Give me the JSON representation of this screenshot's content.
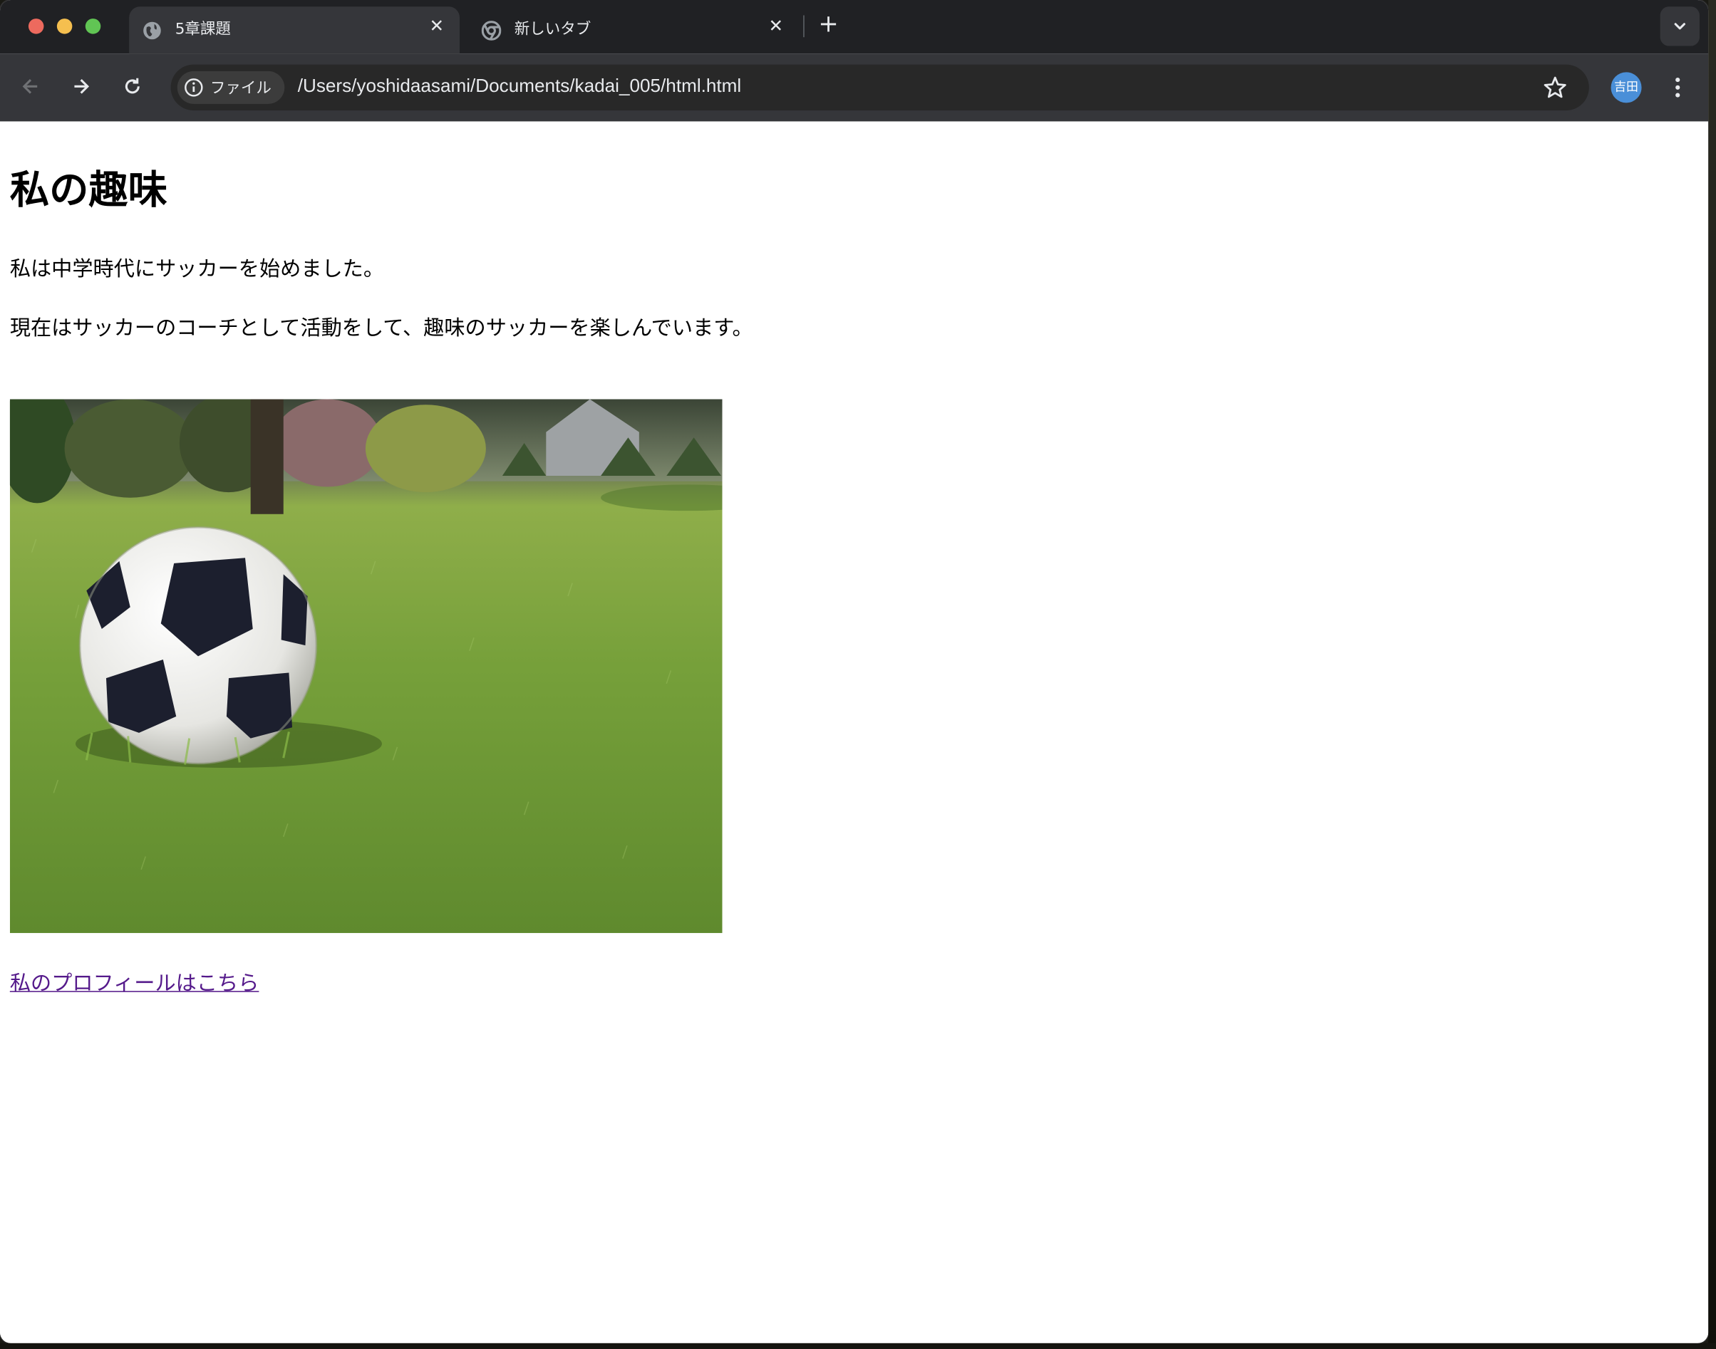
{
  "browser": {
    "tabs": [
      {
        "title": "5章課題",
        "active": true
      },
      {
        "title": "新しいタブ",
        "active": false
      }
    ],
    "close_glyph": "✕",
    "new_tab_glyph": "+",
    "toolbar": {
      "chip_label": "ファイル",
      "url": "/Users/yoshidaasami/Documents/kadai_005/html.html",
      "profile_initials": "吉田"
    }
  },
  "page": {
    "heading": "私の趣味",
    "paragraph_1": "私は中学時代にサッカーを始めました。",
    "paragraph_2": "現在はサッカーのコーチとして活動をして、趣味のサッカーを楽しんでいます。",
    "image_subject": "soccer ball on grass",
    "link_text": "私のプロフィールはこちら"
  },
  "colors": {
    "tab_bar": "#202124",
    "toolbar": "#35363a",
    "link_visited": "#551a8b",
    "avatar": "#4a8fd8"
  }
}
